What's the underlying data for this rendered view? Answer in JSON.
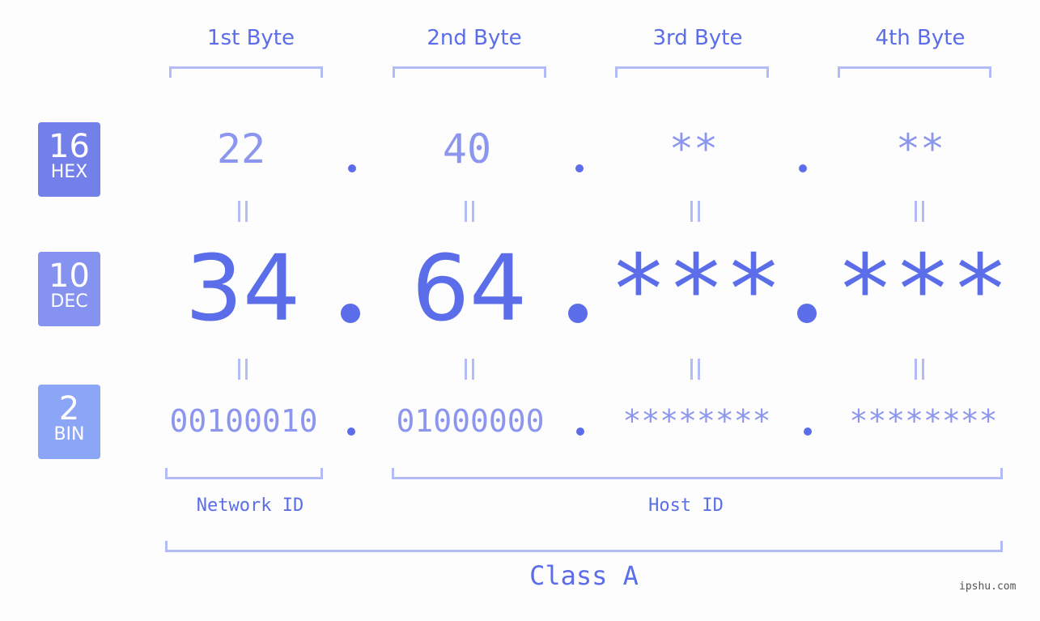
{
  "headers": [
    "1st Byte",
    "2nd Byte",
    "3rd Byte",
    "4th Byte"
  ],
  "badges": {
    "hex": {
      "num": "16",
      "label": "HEX",
      "color": "#7380ea"
    },
    "dec": {
      "num": "10",
      "label": "DEC",
      "color": "#8592f0"
    },
    "bin": {
      "num": "2",
      "label": "BIN",
      "color": "#8ca6f7"
    }
  },
  "hex": [
    "22",
    "40",
    "**",
    "**"
  ],
  "dec": [
    "34",
    "64",
    "***",
    "***"
  ],
  "bin": [
    "00100010",
    "01000000",
    "********",
    "********"
  ],
  "labels": {
    "network_id": "Network ID",
    "host_id": "Host ID",
    "class": "Class A"
  },
  "watermark": "ipshu.com",
  "colors": {
    "accent": "#5b6de8",
    "light": "#8c96ee",
    "bracket": "#b3bcf7"
  }
}
